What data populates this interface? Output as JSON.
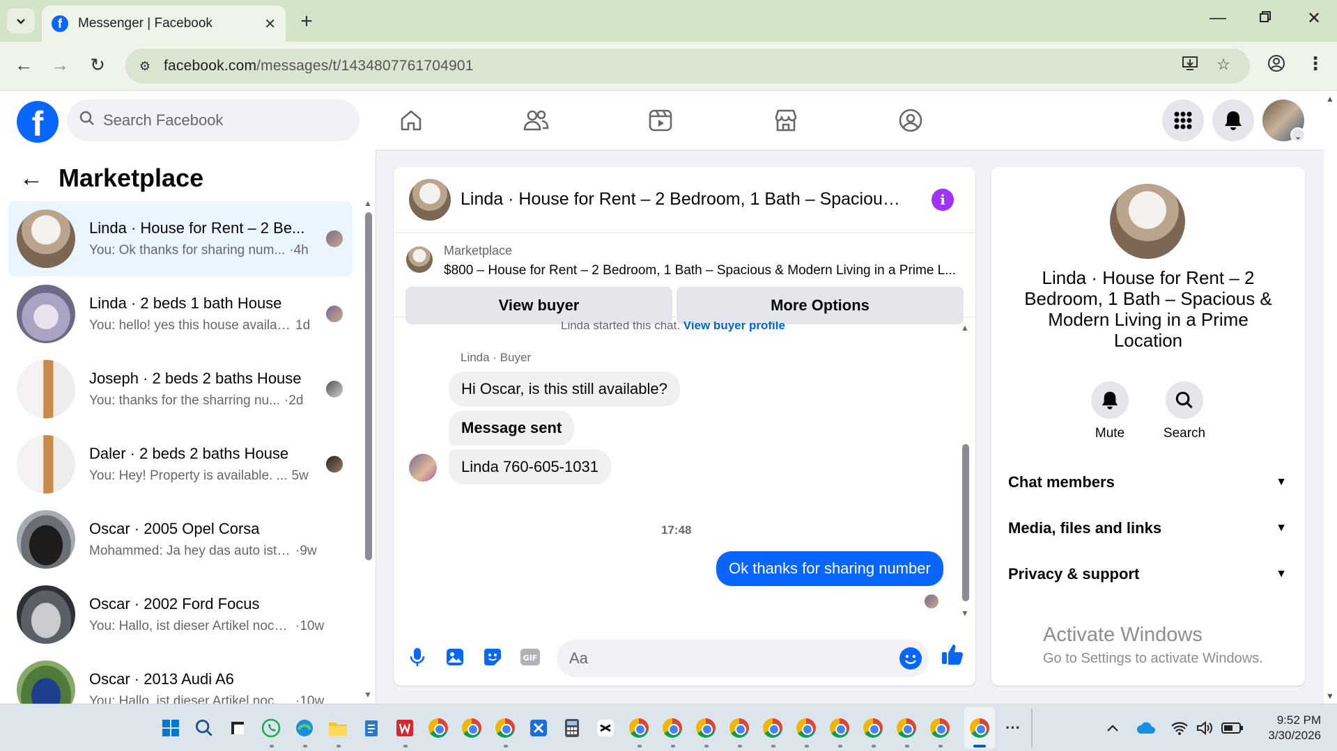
{
  "browser": {
    "tab_title": "Messenger | Facebook",
    "url_host": "facebook.com",
    "url_path": "/messages/t/1434807761704901"
  },
  "fb_nav": {
    "logo": "f",
    "search_placeholder": "Search Facebook"
  },
  "left_panel": {
    "title": "Marketplace",
    "conversations": [
      {
        "name": "Linda · House for Rent – 2 Be...",
        "preview": "You: Ok thanks for sharing num...",
        "time": "·4h",
        "active": true
      },
      {
        "name": "Linda · 2 beds 1 bath House",
        "preview": "You: hello! yes this house availab...",
        "time": "1d"
      },
      {
        "name": "Joseph · 2 beds 2 baths House",
        "preview": "You: thanks for the sharring nu...",
        "time": "·2d"
      },
      {
        "name": "Daler · 2 beds 2 baths House",
        "preview": "You: Hey! Property is available. ...",
        "time": "5w"
      },
      {
        "name": "Oscar · 2005 Opel Corsa",
        "preview": "Mohammed: Ja hey das auto ist no...",
        "time": "·9w"
      },
      {
        "name": "Oscar · 2002 Ford Focus",
        "preview": "You: Hallo, ist dieser Artikel noch ...",
        "time": "·10w"
      },
      {
        "name": "Oscar · 2013 Audi A6",
        "preview": "You: Hallo, ist dieser Artikel noch ...",
        "time": "·10w"
      }
    ]
  },
  "chat": {
    "title": "Linda · House for Rent – 2 Bedroom, 1 Bath – Spacious···",
    "info_icon": "i",
    "listing_source": "Marketplace",
    "listing_desc": "$800 – House for Rent – 2 Bedroom, 1 Bath – Spacious & Modern Living in a Prime L...",
    "view_buyer": "View buyer",
    "more_options": "More Options",
    "started_text": "Linda started this chat.",
    "started_link": "View buyer profile",
    "sender_label": "Linda · Buyer",
    "messages": [
      "Hi Oscar, is this still available?",
      "Message sent",
      "Linda 760-605-1031"
    ],
    "timestamp": "17:48",
    "my_message": "Ok thanks for sharing number",
    "composer_placeholder": "Aa"
  },
  "right_panel": {
    "title": "Linda · House for Rent – 2 Bedroom, 1 Bath – Spacious & Modern Living in a Prime Location",
    "mute_label": "Mute",
    "search_label": "Search",
    "sections": [
      "Chat members",
      "Media, files and links",
      "Privacy & support"
    ],
    "watermark_title": "Activate Windows",
    "watermark_sub": "Go to Settings to activate Windows."
  },
  "taskbar": {
    "time": "9:52 PM",
    "date": "3/30/2026",
    "more": "···"
  },
  "colors": {
    "fb_blue": "#0866ff",
    "active_conv": "#ebf5ff",
    "info_purple": "#a033ff"
  }
}
